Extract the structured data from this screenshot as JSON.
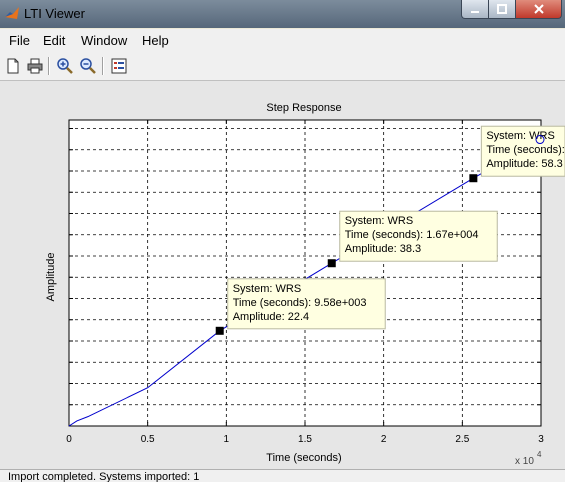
{
  "window": {
    "title": "LTI Viewer"
  },
  "menu": [
    "File",
    "Edit",
    "Window",
    "Help"
  ],
  "toolbar": {
    "icons": [
      "new-icon",
      "print-icon",
      "zoom-in-icon",
      "zoom-out-icon",
      "grid-icon"
    ]
  },
  "plot": {
    "title": "Step Response",
    "xlabel": "Time (seconds)",
    "ylabel": "Amplitude",
    "xmultiplier": "x 10",
    "xexponent": "4"
  },
  "chart_data": {
    "type": "line",
    "title": "Step Response",
    "xlabel": "Time (seconds)",
    "ylabel": "Amplitude",
    "xlim": [
      0,
      30000
    ],
    "ylim": [
      0,
      72
    ],
    "x_tick_labels": [
      "0",
      "0.5",
      "1",
      "1.5",
      "2",
      "2.5",
      "3"
    ],
    "x_tick_values": [
      0,
      5000,
      10000,
      15000,
      20000,
      25000,
      30000
    ],
    "y_tick_values": [
      0,
      5,
      10,
      15,
      20,
      25,
      30,
      35,
      40,
      45,
      50,
      55,
      60,
      65,
      70
    ],
    "grid": true,
    "series": [
      {
        "color": "#0000cc",
        "x": [
          0,
          500,
          1200,
          5000,
          9580,
          16700,
          25700,
          30000
        ],
        "y": [
          0,
          1.2,
          2.2,
          9.0,
          22.4,
          38.3,
          58.3,
          67.4
        ]
      }
    ],
    "datatips": [
      {
        "x": 9580,
        "y": 22.4,
        "system": "System: WRS",
        "time": "Time (seconds): 9.58e+003",
        "amplitude": "Amplitude: 22.4"
      },
      {
        "x": 16700,
        "y": 38.3,
        "system": "System: WRS",
        "time": "Time (seconds): 1.67e+004",
        "amplitude": "Amplitude: 38.3"
      },
      {
        "x": 25700,
        "y": 58.3,
        "system": "System: WRS",
        "time": "Time (seconds):",
        "amplitude": "Amplitude: 58.3"
      }
    ]
  },
  "status": {
    "text": "Import completed. Systems imported: 1"
  }
}
